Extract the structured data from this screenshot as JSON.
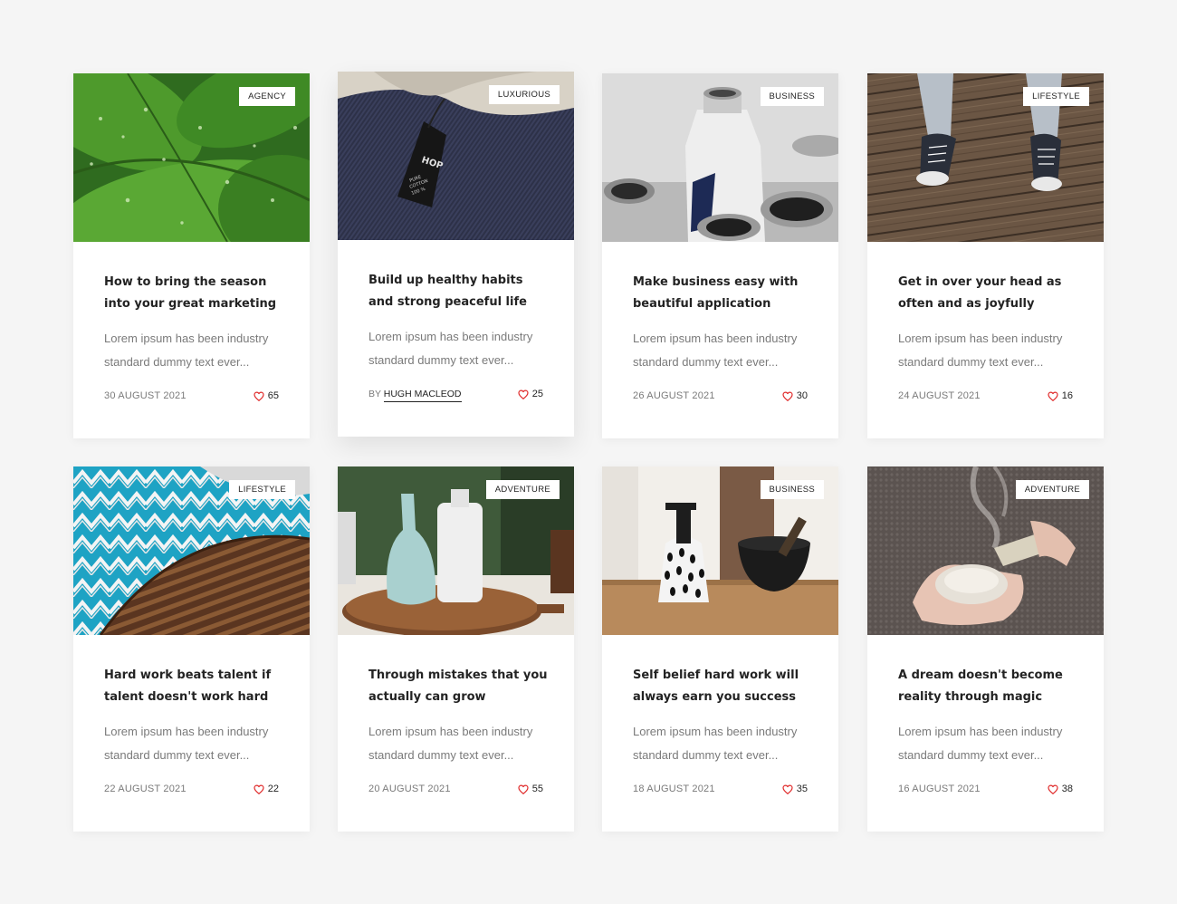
{
  "accent_color": "#e02a2a",
  "cards": [
    {
      "tag": "AGENCY",
      "title": "How to bring the season into your great marketing",
      "excerpt": "Lorem ipsum has been industry standard dummy text ever...",
      "date": "30 AUGUST 2021",
      "likes": "65",
      "image": "green-leaves-with-water-drops"
    },
    {
      "tag": "LUXURIOUS",
      "title": "Build up healthy habits and strong peaceful life",
      "excerpt": "Lorem ipsum has been industry standard dummy text ever...",
      "author_prefix": "BY",
      "author": "HUGH MACLEOD",
      "likes": "25",
      "image": "denim-with-cotton-label"
    },
    {
      "tag": "BUSINESS",
      "title": "Make business easy with beautiful application",
      "excerpt": "Lorem ipsum has been industry standard dummy text ever...",
      "date": "26 AUGUST 2021",
      "likes": "30",
      "image": "aluminum-bottles"
    },
    {
      "tag": "LIFESTYLE",
      "title": "Get in over your head as often and as joyfully",
      "excerpt": "Lorem ipsum has been industry standard dummy text ever...",
      "date": "24 AUGUST 2021",
      "likes": "16",
      "image": "sneakers-on-wooden-deck"
    },
    {
      "tag": "LIFESTYLE",
      "title": "Hard work beats talent if talent doesn't work hard",
      "excerpt": "Lorem ipsum has been industry standard dummy text ever...",
      "date": "22 AUGUST 2021",
      "likes": "22",
      "image": "blue-pattern-cushion-rattan"
    },
    {
      "tag": "ADVENTURE",
      "title": "Through mistakes that you actually can grow",
      "excerpt": "Lorem ipsum has been industry standard dummy text ever...",
      "date": "20 AUGUST 2021",
      "likes": "55",
      "image": "ceramic-vases-on-board"
    },
    {
      "tag": "BUSINESS",
      "title": "Self belief hard work will always earn you success",
      "excerpt": "Lorem ipsum has been industry standard dummy text ever...",
      "date": "18 AUGUST 2021",
      "likes": "35",
      "image": "spray-bottle-and-bowl"
    },
    {
      "tag": "ADVENTURE",
      "title": "A dream doesn't become reality through magic",
      "excerpt": "Lorem ipsum has been industry standard dummy text ever...",
      "date": "16 AUGUST 2021",
      "likes": "38",
      "image": "hands-holding-shell-sage"
    }
  ]
}
